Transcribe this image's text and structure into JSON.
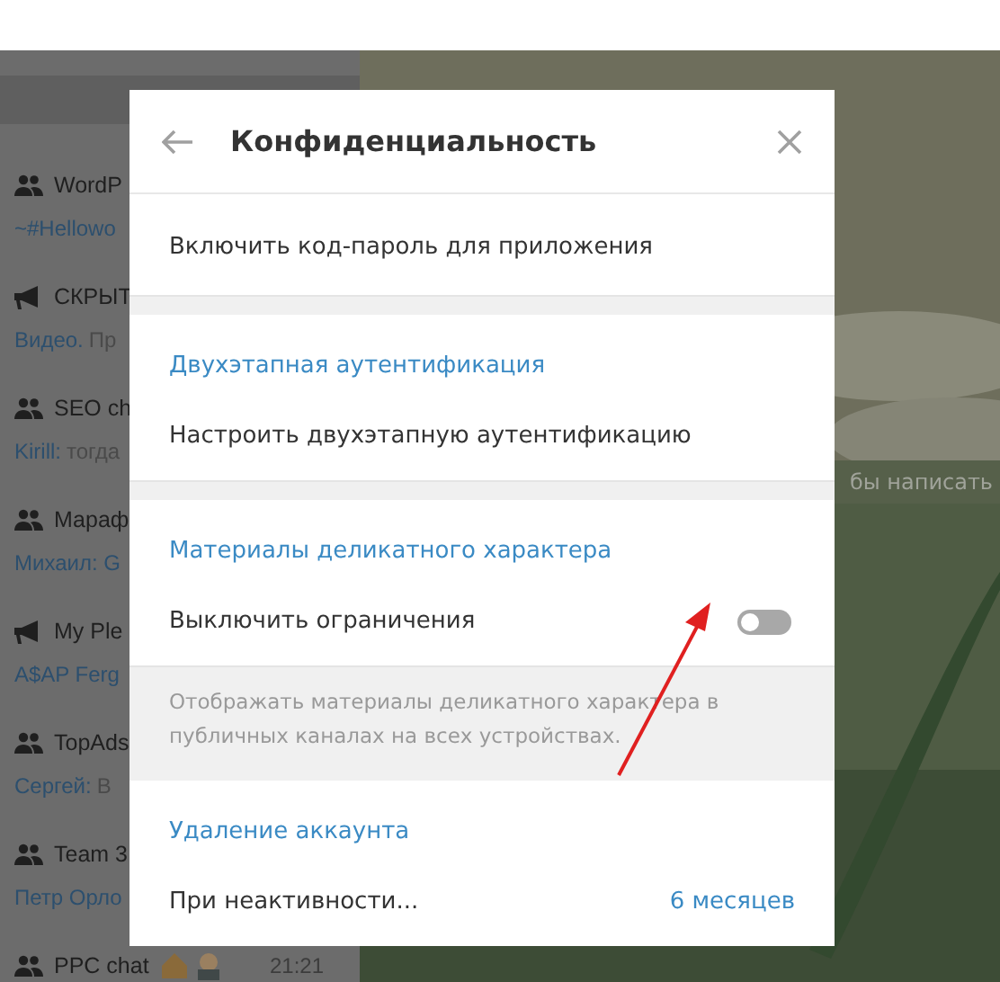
{
  "chat_list": [
    {
      "kind": "group",
      "name": "WordP",
      "sender": "~#Hellowo"
    },
    {
      "kind": "channel",
      "name": "СКРЫТ",
      "sender": "Видео.",
      "preview": "Пр"
    },
    {
      "kind": "group",
      "name": "SEO ch",
      "sender": "Kirill:",
      "preview": "тогда"
    },
    {
      "kind": "group",
      "name": "Мараф",
      "sender": "Михаил: G"
    },
    {
      "kind": "channel",
      "name": "My Ple",
      "sender": "A$AP Ferg"
    },
    {
      "kind": "group",
      "name": "TopAds",
      "sender": "Сергей:",
      "preview": "В"
    },
    {
      "kind": "group",
      "name": "Team 3",
      "sender": "Петр Орло"
    },
    {
      "kind": "group",
      "name": "PPC chat",
      "time": "21:21"
    }
  ],
  "chat_hint": "бы написать",
  "dialog": {
    "title": "Конфиденциальность",
    "sections": [
      {
        "rows": [
          {
            "kind": "link",
            "label": "Включить код-пароль для приложения"
          }
        ]
      },
      {
        "title": "Двухэтапная аутентификация",
        "rows": [
          {
            "kind": "link",
            "label": "Настроить двухэтапную аутентификацию"
          }
        ]
      },
      {
        "title": "Материалы деликатного характера",
        "rows": [
          {
            "kind": "toggle",
            "label": "Выключить ограничения",
            "on": false
          }
        ],
        "note": "Отображать материалы деликатного характера в публичных каналах на всех устройствах."
      },
      {
        "title": "Удаление аккаунта",
        "rows": [
          {
            "kind": "value",
            "label": "При неактивности...",
            "value": "6 месяцев"
          }
        ]
      }
    ]
  }
}
